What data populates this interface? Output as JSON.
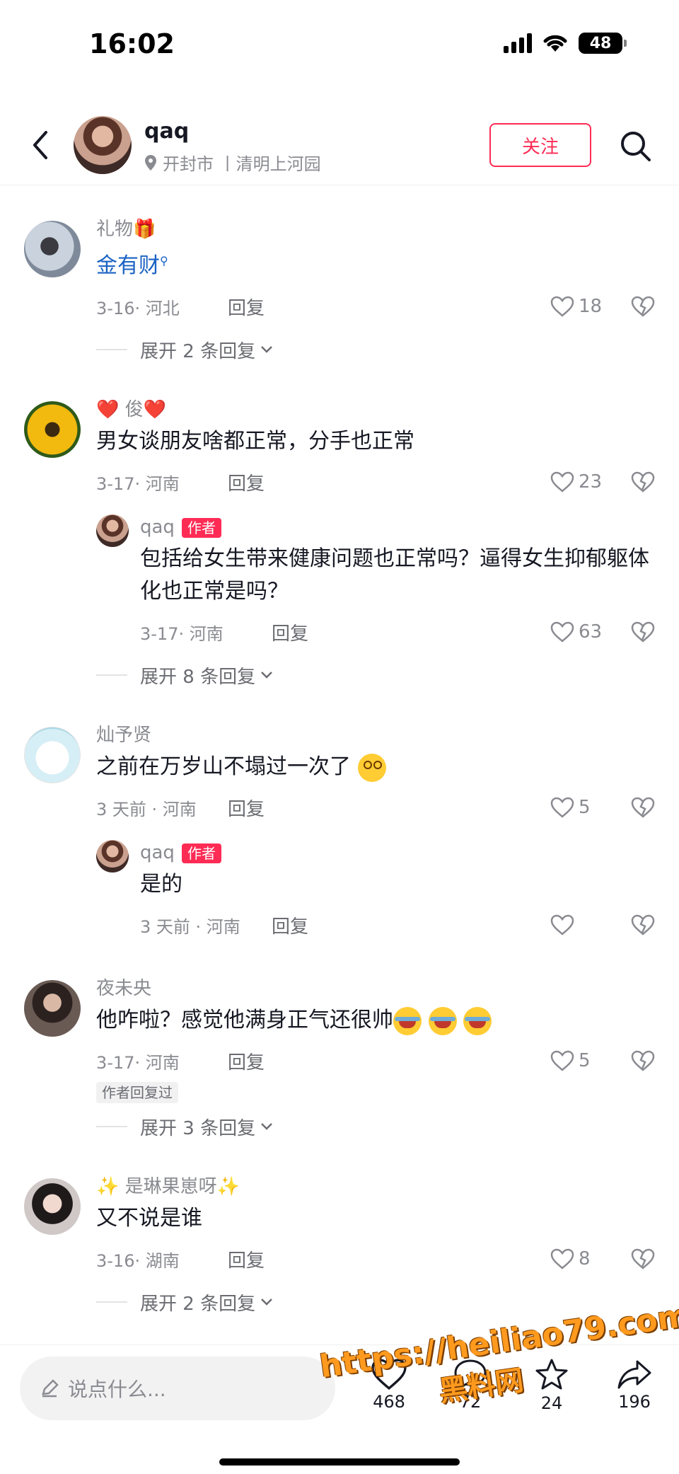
{
  "status_bar": {
    "time": "16:02",
    "battery": "48"
  },
  "header": {
    "name": "qaq",
    "location": "开封市 丨清明上河园",
    "follow_label": "关注"
  },
  "comments": [
    {
      "name": "礼物🎁",
      "text": "金有财",
      "date": "3-16· 河北",
      "reply_label": "回复",
      "likes": "18",
      "expand": "展开 2 条回复"
    },
    {
      "name": "❤️ 俊❤️",
      "text": "男女谈朋友啥都正常，分手也正常",
      "date": "3-17· 河南",
      "reply_label": "回复",
      "likes": "23",
      "expand": "展开 8 条回复",
      "reply": {
        "name": "qaq",
        "tag": "作者",
        "text": "包括给女生带来健康问题也正常吗？逼得女生抑郁躯体化也正常是吗？",
        "date": "3-17· 河南",
        "reply_label": "回复",
        "likes": "63"
      }
    },
    {
      "name": "灿予贤",
      "text": "之前在万岁山不塌过一次了",
      "date": "3 天前 · 河南",
      "reply_label": "回复",
      "likes": "5",
      "reply": {
        "name": "qaq",
        "tag": "作者",
        "text": "是的",
        "date": "3 天前 · 河南",
        "reply_label": "回复",
        "likes": ""
      }
    },
    {
      "name": "夜未央",
      "text": "他咋啦？感觉他满身正气还很帅",
      "date": "3-17· 河南",
      "reply_label": "回复",
      "likes": "5",
      "replied_tag": "作者回复过",
      "expand": "展开 3 条回复"
    },
    {
      "name": "✨ 是琳果崽呀✨",
      "text": "又不说是谁",
      "date": "3-16· 湖南",
      "reply_label": "回复",
      "likes": "8",
      "expand": "展开 2 条回复"
    }
  ],
  "bottom_bar": {
    "input_placeholder": "说点什么...",
    "likes_count": "468",
    "comments_count": "72",
    "favorites_count": "24",
    "shares_count": "196"
  },
  "watermark": {
    "line1": "https://heiliao79.com",
    "line2": "黑料网"
  },
  "icons": [
    "back-icon",
    "location-pin-icon",
    "search-icon",
    "heart-icon",
    "dislike-icon",
    "chevron-down-icon",
    "pencil-icon",
    "comment-icon",
    "star-icon",
    "share-icon"
  ],
  "colors": {
    "accent": "#fe2c55",
    "link": "#1a62c4",
    "muted": "#8a8b91"
  }
}
